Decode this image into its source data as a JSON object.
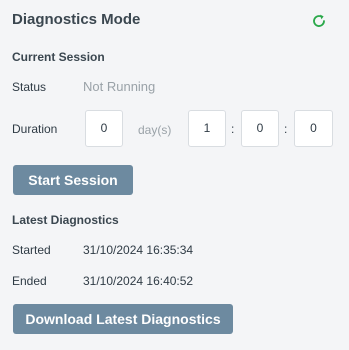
{
  "header": {
    "title": "Diagnostics Mode",
    "refresh_icon": "refresh-icon",
    "accent": "#2aa84a"
  },
  "current_session": {
    "heading": "Current Session",
    "status_label": "Status",
    "status_value": "Not Running",
    "duration_label": "Duration",
    "days": "0",
    "days_unit": "day(s)",
    "hours": "1",
    "minutes": "0",
    "seconds": "0",
    "sep1": ":",
    "sep2": ":",
    "start_button": "Start Session"
  },
  "latest": {
    "heading": "Latest Diagnostics",
    "started_label": "Started",
    "started_value": "31/10/2024 16:35:34",
    "ended_label": "Ended",
    "ended_value": "31/10/2024 16:40:52",
    "download_button": "Download Latest Diagnostics"
  },
  "colors": {
    "button": "#6d8aa0",
    "muted": "#9aa2a8"
  }
}
